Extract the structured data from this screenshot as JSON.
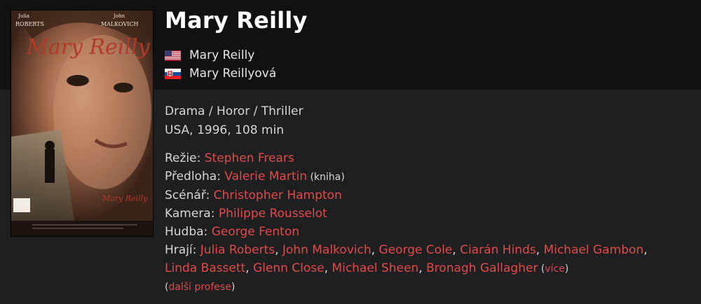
{
  "film": {
    "title": "Mary Reilly",
    "titles": [
      {
        "flag": "us-flag-icon",
        "name": "Mary Reilly"
      },
      {
        "flag": "sk-flag-icon",
        "name": "Mary Reillyová"
      }
    ],
    "genres": "Drama / Horor / Thriller",
    "origin": "USA, 1996, 108 min"
  },
  "poster": {
    "actor1_first": "Julia",
    "actor1_last": "ROBERTS",
    "actor2_first": "John",
    "actor2_last": "MALKOVICH",
    "script_title": "Mary Reilly",
    "bottom_script": "Mary Reilly"
  },
  "credits": {
    "directing": {
      "label": "Režie: ",
      "people": [
        "Stephen Frears"
      ]
    },
    "source": {
      "label": "Předloha: ",
      "people": [
        "Valerie Martin"
      ],
      "note": " (kniha)"
    },
    "screenplay": {
      "label": "Scénář: ",
      "people": [
        "Christopher Hampton"
      ]
    },
    "camera": {
      "label": "Kamera: ",
      "people": [
        "Philippe Rousselot"
      ]
    },
    "music": {
      "label": "Hudba: ",
      "people": [
        "George Fenton"
      ]
    },
    "cast": {
      "label": "Hrají: ",
      "people": [
        "Julia Roberts",
        "John Malkovich",
        "George Cole",
        "Ciarán Hinds",
        "Michael Gambon",
        "Linda Bassett",
        "Glenn Close",
        "Michael Sheen",
        "Bronagh Gallagher"
      ],
      "separator": ", ",
      "more_open": " (",
      "more_label": "více",
      "more_close": ")"
    },
    "other_open": "(",
    "other_label": "další profese",
    "other_close": ")"
  },
  "colors": {
    "link": "#e24a4a",
    "text": "#d6d6d6",
    "title": "#ffffff",
    "header_bg": "#111112",
    "page_bg": "#1e1f21"
  }
}
